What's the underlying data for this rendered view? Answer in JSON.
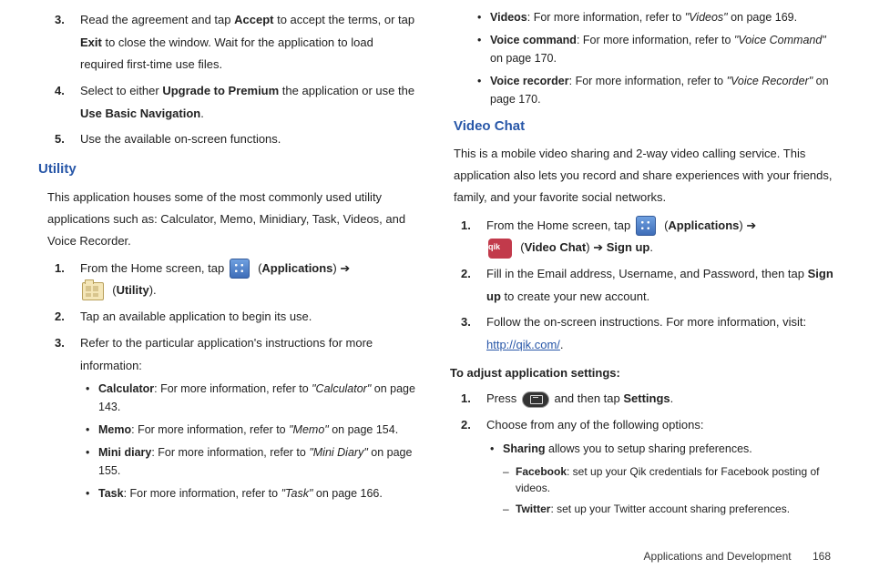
{
  "left": {
    "steps_a": [
      {
        "n": "3.",
        "pre": "Read the agreement and tap ",
        "b1": "Accept",
        "mid": " to accept the terms, or tap ",
        "b2": "Exit",
        "post": " to close the window. Wait for the application to load required first-time use files."
      },
      {
        "n": "4.",
        "pre": "Select to either ",
        "b1": "Upgrade to Premium",
        "mid": " the application or use the ",
        "b2": "Use Basic Navigation",
        "post": "."
      },
      {
        "n": "5.",
        "pre": "Use the available on-screen functions.",
        "b1": "",
        "mid": "",
        "b2": "",
        "post": ""
      }
    ],
    "utility_head": "Utility",
    "utility_intro": "This application houses some of the most commonly used utility applications such as: Calculator, Memo, Minidiary, Task, Videos, and Voice Recorder.",
    "utility_step1_pre": "From the Home screen, tap ",
    "utility_step1_apps": "Applications",
    "utility_step1_util": "Utility",
    "utility_step2": "Tap an available application to begin its use.",
    "utility_step3": "Refer to the particular application's instructions for more information:",
    "bullets": [
      {
        "b": "Calculator",
        "t": ": For more information, refer to ",
        "i": "\"Calculator\"",
        "p": "  on page 143."
      },
      {
        "b": "Memo",
        "t": ": For more information, refer to ",
        "i": "\"Memo\"",
        "p": "  on page 154."
      },
      {
        "b": "Mini diary",
        "t": ": For more information, refer to ",
        "i": "\"Mini Diary\"",
        "p": "  on page 155."
      },
      {
        "b": "Task",
        "t": ": For more information, refer to ",
        "i": "\"Task\"",
        "p": "  on page 166."
      }
    ]
  },
  "right": {
    "top_bullets": [
      {
        "b": "Videos",
        "t": ": For more information, refer to ",
        "i": "\"Videos\"",
        "p": "  on page 169."
      },
      {
        "b": "Voice command",
        "t": ": For more information, refer to ",
        "i": "\"Voice Command\"",
        "p": "  on page 170."
      },
      {
        "b": "Voice recorder",
        "t": ": For more information, refer to ",
        "i": "\"Voice Recorder\"",
        "p": " on page 170."
      }
    ],
    "vc_head": "Video Chat",
    "vc_intro": "This is a mobile video sharing and 2-way video calling service. This application also lets you record and share experiences with your friends, family, and your favorite social networks.",
    "vc_step1_pre": "From the Home screen, tap ",
    "vc_step1_apps": "Applications",
    "vc_step1_vc": "Video Chat",
    "vc_step1_su": "Sign up",
    "vc_step2_pre": "Fill in the Email address, Username, and Password, then tap ",
    "vc_step2_b": "Sign up",
    "vc_step2_post": " to create your new account.",
    "vc_step3_pre": "Follow the on-screen instructions. For more information, visit: ",
    "vc_step3_link": "http://qik.com/",
    "adjust_head": "To adjust application settings:",
    "adj_step1_pre": "Press ",
    "adj_step1_mid": " and then tap ",
    "adj_step1_b": "Settings",
    "adj_step2": "Choose from any of the following options:",
    "adj_bullet_b": "Sharing",
    "adj_bullet_t": " allows you to setup sharing preferences.",
    "dashes": [
      {
        "b": "Facebook",
        "t": ": set up your Qik credentials for Facebook posting of videos."
      },
      {
        "b": "Twitter",
        "t": ": set up your Twitter account sharing preferences."
      }
    ]
  },
  "footer": {
    "section": "Applications and Development",
    "page": "168"
  },
  "qik_label": "qik"
}
